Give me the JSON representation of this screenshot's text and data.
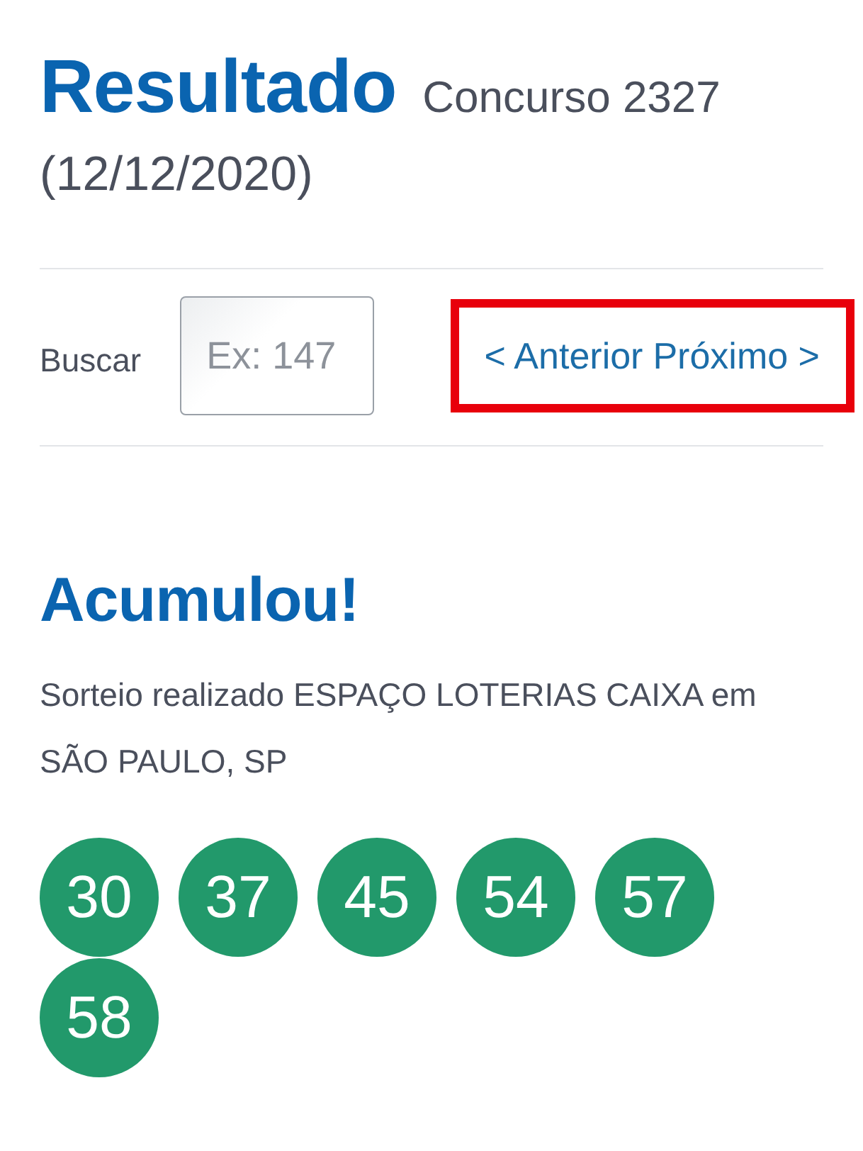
{
  "header": {
    "title": "Resultado",
    "contest": "Concurso 2327",
    "date": "(12/12/2020)"
  },
  "search": {
    "label": "Buscar",
    "placeholder": "Ex: 147"
  },
  "nav": {
    "highlighted": true,
    "links": [
      {
        "label": "< Anterior"
      },
      {
        "label": "Próximo >"
      }
    ]
  },
  "result": {
    "status": "Acumulou!",
    "description": "Sorteio realizado ESPAÇO LOTERIAS CAIXA em SÃO PAULO, SP"
  },
  "numbers": [
    "30",
    "37",
    "45",
    "54",
    "57",
    "58"
  ]
}
